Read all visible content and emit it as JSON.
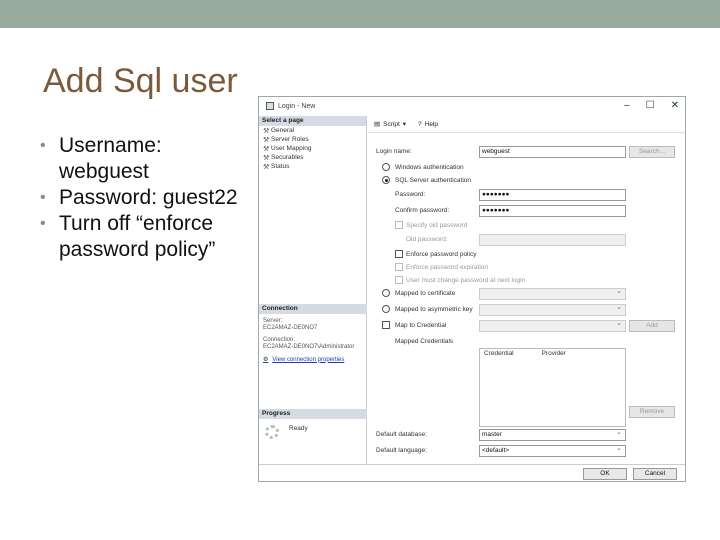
{
  "slide": {
    "title": "Add Sql user",
    "bullets": [
      "Username: webguest",
      "Password: guest22",
      "Turn off “enforce password policy”"
    ]
  },
  "dialog": {
    "window_title": "Login - New",
    "select_a_page": "Select a page",
    "pages": [
      "General",
      "Server Roles",
      "User Mapping",
      "Securables",
      "Status"
    ],
    "toolbar": {
      "script": "Script",
      "help": "Help"
    },
    "login_name_label": "Login name:",
    "login_name_value": "webguest",
    "search_button": "Search...",
    "windows_auth": "Windows authentication",
    "sql_auth": "SQL Server authentication",
    "password_label": "Password:",
    "password_value": "●●●●●●●",
    "confirm_label": "Confirm password:",
    "confirm_value": "●●●●●●●",
    "specify_old": "Specify old password",
    "old_password_label": "Old password:",
    "enforce_policy": "Enforce password policy",
    "enforce_expiration": "Enforce password expiration",
    "must_change": "User must change password at next login",
    "mapped_cert": "Mapped to certificate",
    "mapped_asym": "Mapped to asymmetric key",
    "map_credential": "Map to Credential",
    "add_button": "Add",
    "mapped_credentials": "Mapped Credentials",
    "cred_col_1": "Credential",
    "cred_col_2": "Provider",
    "remove_button": "Remove",
    "default_db_label": "Default database:",
    "default_db_value": "master",
    "default_lang_label": "Default language:",
    "default_lang_value": "<default>",
    "connection_header": "Connection",
    "server_label": "Server:",
    "server_value": "EC2AMAZ-DE0NO7",
    "connection_label": "Connection:",
    "connection_value": "EC2AMAZ-DE0NO7\\Administrator",
    "view_props": "View connection properties",
    "progress_header": "Progress",
    "ready": "Ready",
    "ok_button": "OK",
    "cancel_button": "Cancel"
  }
}
